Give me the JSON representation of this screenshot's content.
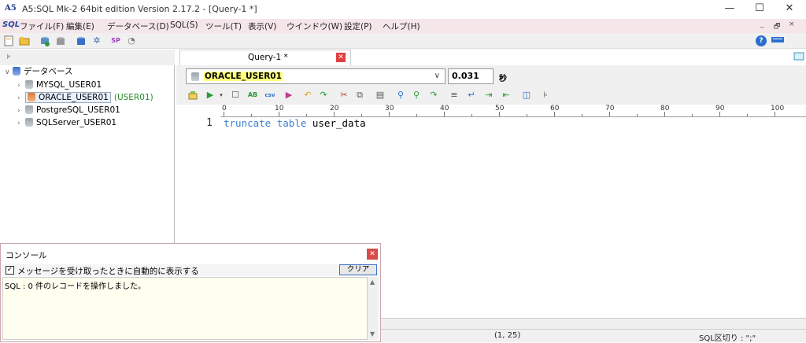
{
  "window": {
    "app_logo": "A5",
    "title": "A5:SQL Mk-2 64bit edition Version 2.17.2 - [Query-1 *]",
    "minimize": "—",
    "maximize": "☐",
    "close": "✕"
  },
  "menubar": {
    "logo": "SQL",
    "items": [
      "ファイル(F)",
      "編集(E)",
      "データベース(D)",
      "SQL(S)",
      "ツール(T)",
      "表示(V)",
      "ウインドウ(W)",
      "設定(P)",
      "ヘルプ(H)"
    ],
    "mdi_min": "_",
    "mdi_restore": "🗗",
    "mdi_close": "×"
  },
  "tree": {
    "root_label": "データベース",
    "items": [
      {
        "label": "MYSQL_USER01",
        "suffix": ""
      },
      {
        "label": "ORACLE_USER01",
        "suffix": "(USER01)"
      },
      {
        "label": "PostgreSQL_USER01",
        "suffix": ""
      },
      {
        "label": "SQLServer_USER01",
        "suffix": ""
      }
    ]
  },
  "query": {
    "tab_label": "Query-1 *",
    "connection": "ORACLE_USER01",
    "elapsed": "0.031",
    "elapsed_unit": "秒",
    "line_number": "1",
    "code_keyword": "truncate table",
    "code_rest": " user_data",
    "ruler_labels": [
      "0",
      "10",
      "20",
      "30",
      "40",
      "50",
      "60",
      "70",
      "80",
      "90",
      "100"
    ]
  },
  "status": {
    "cursor": "(1, 25)",
    "delimiter": "SQL区切り : \";\""
  },
  "console": {
    "title": "コンソール",
    "auto_show_label": "メッセージを受け取ったときに自動的に表示する",
    "auto_show_checked": "✓",
    "clear_label": "クリア",
    "message": "SQL  : 0 件のレコードを操作しました。"
  }
}
